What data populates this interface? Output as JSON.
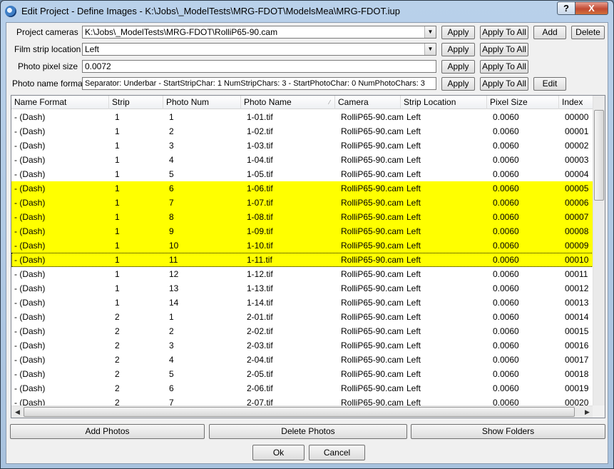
{
  "window": {
    "title": "Edit Project - Define Images - K:\\Jobs\\_ModelTests\\MRG-FDOT\\ModelsMea\\MRG-FDOT.iup",
    "help_label": "?",
    "close_label": "X"
  },
  "form": {
    "project_cameras": {
      "label": "Project cameras",
      "value": "K:\\Jobs\\_ModelTests\\MRG-FDOT\\RolliP65-90.cam",
      "apply": "Apply",
      "apply_all": "Apply To All",
      "add": "Add",
      "delete": "Delete"
    },
    "film_strip": {
      "label": "Film strip location",
      "value": "Left",
      "apply": "Apply",
      "apply_all": "Apply To All"
    },
    "pixel_size": {
      "label": "Photo pixel size",
      "value": "0.0072",
      "apply": "Apply",
      "apply_all": "Apply To All"
    },
    "name_format": {
      "label": "Photo name format",
      "value": "Separator: Underbar - StartStripChar: 1 NumStripChars: 3 - StartPhotoChar: 0 NumPhotoChars: 3",
      "apply": "Apply",
      "apply_all": "Apply To All",
      "edit": "Edit"
    }
  },
  "table": {
    "columns": [
      "Name Format",
      "Strip",
      "Photo Num",
      "Photo Name",
      "Camera",
      "Strip Location",
      "Pixel Size",
      "Index"
    ],
    "rows": [
      {
        "fmt": "- (Dash)",
        "strip": "1",
        "num": "1",
        "name": "1-01.tif",
        "camera": "RolliP65-90.cam",
        "loc": "Left",
        "px": "0.0060",
        "idx": "00000",
        "sel": false
      },
      {
        "fmt": "- (Dash)",
        "strip": "1",
        "num": "2",
        "name": "1-02.tif",
        "camera": "RolliP65-90.cam",
        "loc": "Left",
        "px": "0.0060",
        "idx": "00001",
        "sel": false
      },
      {
        "fmt": "- (Dash)",
        "strip": "1",
        "num": "3",
        "name": "1-03.tif",
        "camera": "RolliP65-90.cam",
        "loc": "Left",
        "px": "0.0060",
        "idx": "00002",
        "sel": false
      },
      {
        "fmt": "- (Dash)",
        "strip": "1",
        "num": "4",
        "name": "1-04.tif",
        "camera": "RolliP65-90.cam",
        "loc": "Left",
        "px": "0.0060",
        "idx": "00003",
        "sel": false
      },
      {
        "fmt": "- (Dash)",
        "strip": "1",
        "num": "5",
        "name": "1-05.tif",
        "camera": "RolliP65-90.cam",
        "loc": "Left",
        "px": "0.0060",
        "idx": "00004",
        "sel": false
      },
      {
        "fmt": "- (Dash)",
        "strip": "1",
        "num": "6",
        "name": "1-06.tif",
        "camera": "RolliP65-90.cam",
        "loc": "Left",
        "px": "0.0060",
        "idx": "00005",
        "sel": true
      },
      {
        "fmt": "- (Dash)",
        "strip": "1",
        "num": "7",
        "name": "1-07.tif",
        "camera": "RolliP65-90.cam",
        "loc": "Left",
        "px": "0.0060",
        "idx": "00006",
        "sel": true
      },
      {
        "fmt": "- (Dash)",
        "strip": "1",
        "num": "8",
        "name": "1-08.tif",
        "camera": "RolliP65-90.cam",
        "loc": "Left",
        "px": "0.0060",
        "idx": "00007",
        "sel": true
      },
      {
        "fmt": "- (Dash)",
        "strip": "1",
        "num": "9",
        "name": "1-09.tif",
        "camera": "RolliP65-90.cam",
        "loc": "Left",
        "px": "0.0060",
        "idx": "00008",
        "sel": true
      },
      {
        "fmt": "- (Dash)",
        "strip": "1",
        "num": "10",
        "name": "1-10.tif",
        "camera": "RolliP65-90.cam",
        "loc": "Left",
        "px": "0.0060",
        "idx": "00009",
        "sel": true
      },
      {
        "fmt": "- (Dash)",
        "strip": "1",
        "num": "11",
        "name": "1-11.tif",
        "camera": "RolliP65-90.cam",
        "loc": "Left",
        "px": "0.0060",
        "idx": "00010",
        "sel": true,
        "focus": true
      },
      {
        "fmt": "- (Dash)",
        "strip": "1",
        "num": "12",
        "name": "1-12.tif",
        "camera": "RolliP65-90.cam",
        "loc": "Left",
        "px": "0.0060",
        "idx": "00011",
        "sel": false
      },
      {
        "fmt": "- (Dash)",
        "strip": "1",
        "num": "13",
        "name": "1-13.tif",
        "camera": "RolliP65-90.cam",
        "loc": "Left",
        "px": "0.0060",
        "idx": "00012",
        "sel": false
      },
      {
        "fmt": "- (Dash)",
        "strip": "1",
        "num": "14",
        "name": "1-14.tif",
        "camera": "RolliP65-90.cam",
        "loc": "Left",
        "px": "0.0060",
        "idx": "00013",
        "sel": false
      },
      {
        "fmt": "- (Dash)",
        "strip": "2",
        "num": "1",
        "name": "2-01.tif",
        "camera": "RolliP65-90.cam",
        "loc": "Left",
        "px": "0.0060",
        "idx": "00014",
        "sel": false
      },
      {
        "fmt": "- (Dash)",
        "strip": "2",
        "num": "2",
        "name": "2-02.tif",
        "camera": "RolliP65-90.cam",
        "loc": "Left",
        "px": "0.0060",
        "idx": "00015",
        "sel": false
      },
      {
        "fmt": "- (Dash)",
        "strip": "2",
        "num": "3",
        "name": "2-03.tif",
        "camera": "RolliP65-90.cam",
        "loc": "Left",
        "px": "0.0060",
        "idx": "00016",
        "sel": false
      },
      {
        "fmt": "- (Dash)",
        "strip": "2",
        "num": "4",
        "name": "2-04.tif",
        "camera": "RolliP65-90.cam",
        "loc": "Left",
        "px": "0.0060",
        "idx": "00017",
        "sel": false
      },
      {
        "fmt": "- (Dash)",
        "strip": "2",
        "num": "5",
        "name": "2-05.tif",
        "camera": "RolliP65-90.cam",
        "loc": "Left",
        "px": "0.0060",
        "idx": "00018",
        "sel": false
      },
      {
        "fmt": "- (Dash)",
        "strip": "2",
        "num": "6",
        "name": "2-06.tif",
        "camera": "RolliP65-90.cam",
        "loc": "Left",
        "px": "0.0060",
        "idx": "00019",
        "sel": false
      },
      {
        "fmt": "- (Dash)",
        "strip": "2",
        "num": "7",
        "name": "2-07.tif",
        "camera": "RolliP65-90.cam",
        "loc": "Left",
        "px": "0.0060",
        "idx": "00020",
        "sel": false
      }
    ]
  },
  "actions": {
    "add_photos": "Add Photos",
    "delete_photos": "Delete Photos",
    "show_folders": "Show Folders",
    "ok": "Ok",
    "cancel": "Cancel"
  },
  "colors": {
    "selection": "#ffff00",
    "title_bar": "#b9d1ea",
    "close": "#c24a33"
  },
  "icons": {
    "app": "app-globe-icon",
    "combo": "chevron-down-icon",
    "sort": "sort-indicator-icon"
  }
}
